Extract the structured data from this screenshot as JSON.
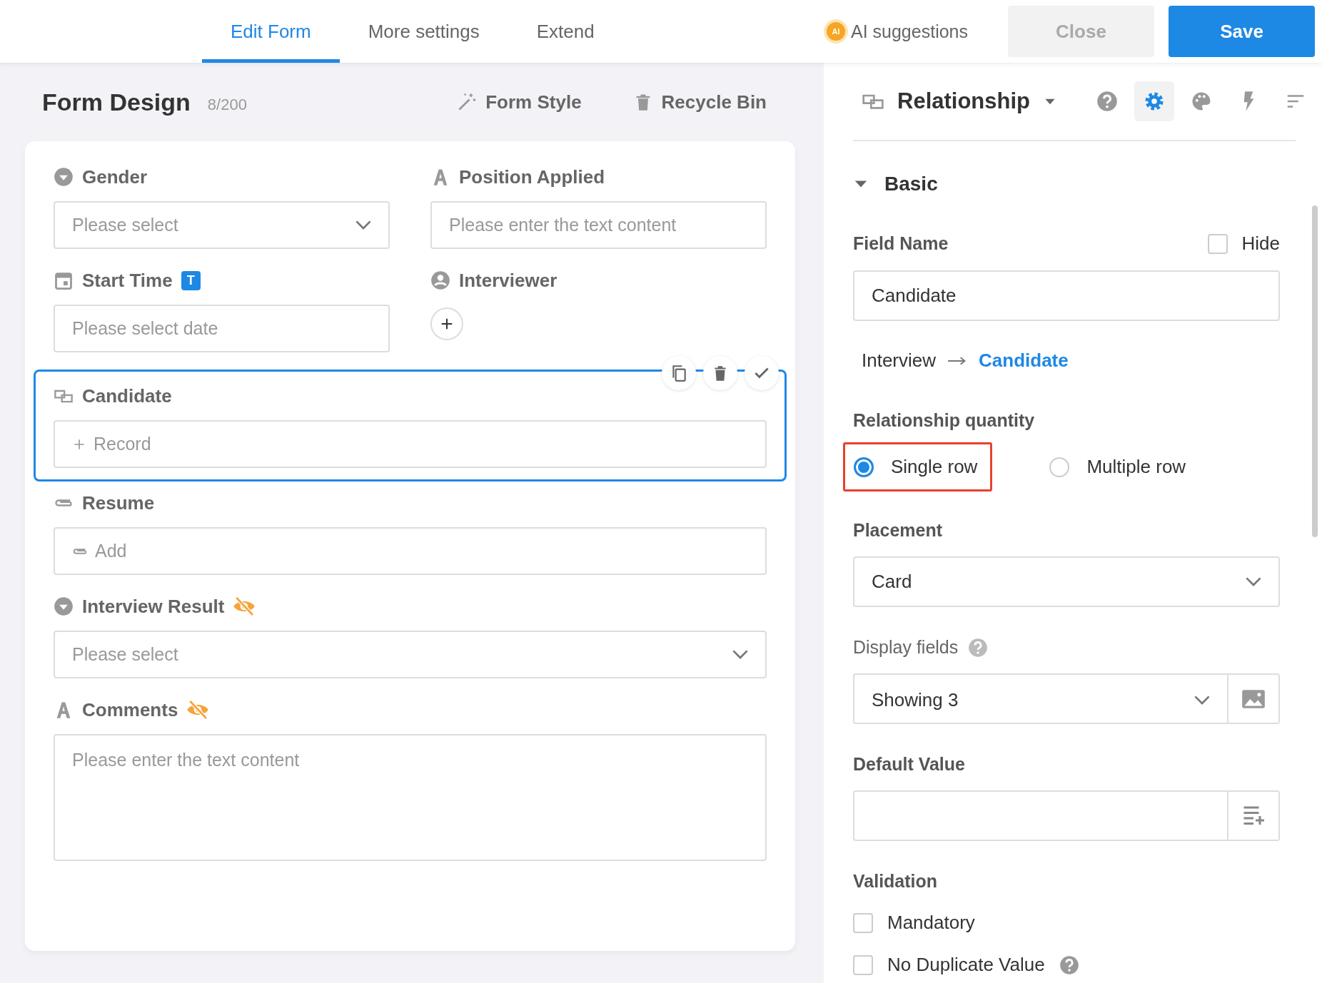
{
  "top_bar": {
    "tabs": [
      {
        "label": "Edit Form",
        "selected": true
      },
      {
        "label": "More settings",
        "selected": false
      },
      {
        "label": "Extend",
        "selected": false
      }
    ],
    "ai_button": {
      "label": "AI suggestions",
      "badge": "AI"
    },
    "buttons": [
      {
        "label": "Close",
        "kind": "secondary"
      },
      {
        "label": "Save",
        "kind": "primary"
      }
    ]
  },
  "form_header": {
    "title": "Form Design",
    "count": "8/200",
    "actions": [
      {
        "label": "Form Style",
        "kind": "wand"
      },
      {
        "label": "Recycle Bin",
        "kind": "trash"
      }
    ]
  },
  "form_rows": [
    [
      {
        "label": "Gender",
        "kind": "select",
        "placeholder": "Please select",
        "hidden": false,
        "selected": false
      },
      {
        "label": "Position Applied",
        "kind": "text",
        "placeholder": "Please enter the text content",
        "hidden": false,
        "selected": false
      }
    ],
    [
      {
        "label": "Start Time",
        "kind": "date",
        "placeholder": "Please select date",
        "badge": "T",
        "hidden": false,
        "selected": false
      },
      {
        "label": "Interviewer",
        "kind": "user",
        "hidden": false,
        "selected": false
      }
    ],
    [
      {
        "label": "Candidate",
        "kind": "relation",
        "placeholder": "Record",
        "hidden": false,
        "selected": true
      }
    ],
    [
      {
        "label": "Resume",
        "kind": "attachment",
        "placeholder": "Add",
        "hidden": false,
        "selected": false
      }
    ],
    [
      {
        "label": "Interview Result",
        "kind": "select",
        "placeholder": "Please select",
        "hidden": true,
        "selected": false
      }
    ],
    [
      {
        "label": "Comments",
        "kind": "textarea",
        "placeholder": "Please enter the text content",
        "hidden": true,
        "selected": false
      }
    ]
  ],
  "panel": {
    "field_type": "Relationship",
    "tools": [
      {
        "kind": "help",
        "selected": false
      },
      {
        "kind": "settings",
        "selected": true
      },
      {
        "kind": "palette",
        "selected": false
      },
      {
        "kind": "bolt",
        "selected": false
      },
      {
        "kind": "sort",
        "selected": false
      }
    ],
    "section": {
      "title": "Basic",
      "expanded": true
    },
    "field_name": {
      "label": "Field Name",
      "value": "Candidate",
      "hide_label": "Hide",
      "hide_checked": false
    },
    "relation": {
      "from": "Interview",
      "to": "Candidate"
    },
    "quantity": {
      "label": "Relationship quantity",
      "options": [
        {
          "label": "Single row",
          "selected": true,
          "highlighted": true
        },
        {
          "label": "Multiple row",
          "selected": false,
          "highlighted": false
        }
      ]
    },
    "placement": {
      "label": "Placement",
      "value": "Card"
    },
    "display_fields": {
      "label": "Display fields",
      "value": "Showing 3"
    },
    "default_value": {
      "label": "Default Value"
    },
    "validation": {
      "label": "Validation",
      "options": [
        {
          "label": "Mandatory",
          "checked": false,
          "help": false
        },
        {
          "label": "No Duplicate Value",
          "checked": false,
          "help": true
        }
      ]
    }
  }
}
